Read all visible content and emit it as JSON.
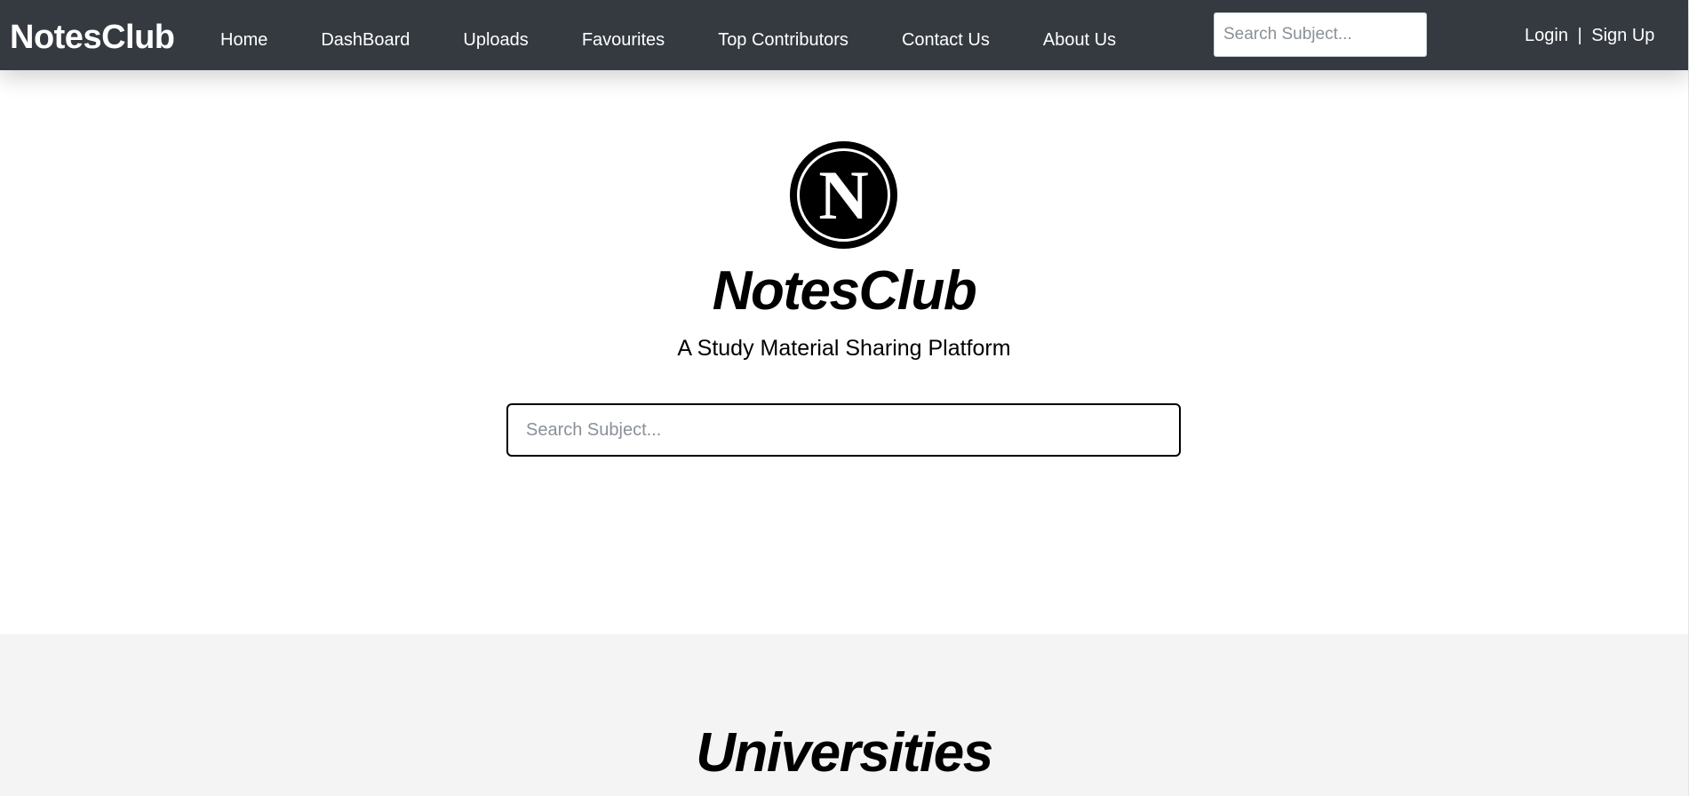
{
  "navbar": {
    "brand": "NotesClub",
    "links": [
      {
        "label": "Home"
      },
      {
        "label": "DashBoard"
      },
      {
        "label": "Uploads"
      },
      {
        "label": "Favourites"
      },
      {
        "label": "Top Contributors"
      },
      {
        "label": "Contact Us"
      },
      {
        "label": "About Us"
      }
    ],
    "search_placeholder": "Search Subject...",
    "login_label": "Login",
    "separator": "|",
    "signup_label": "Sign Up"
  },
  "hero": {
    "logo_letter": "N",
    "title": "NotesClub",
    "subtitle": "A Study Material Sharing Platform",
    "search_placeholder": "Search Subject..."
  },
  "universities": {
    "title": "Universities"
  },
  "colors": {
    "navbar_bg": "#343a40",
    "section_bg": "#f4f4f4",
    "text": "#000000"
  },
  "icons": {
    "logo": "notesclub-logo-icon"
  }
}
